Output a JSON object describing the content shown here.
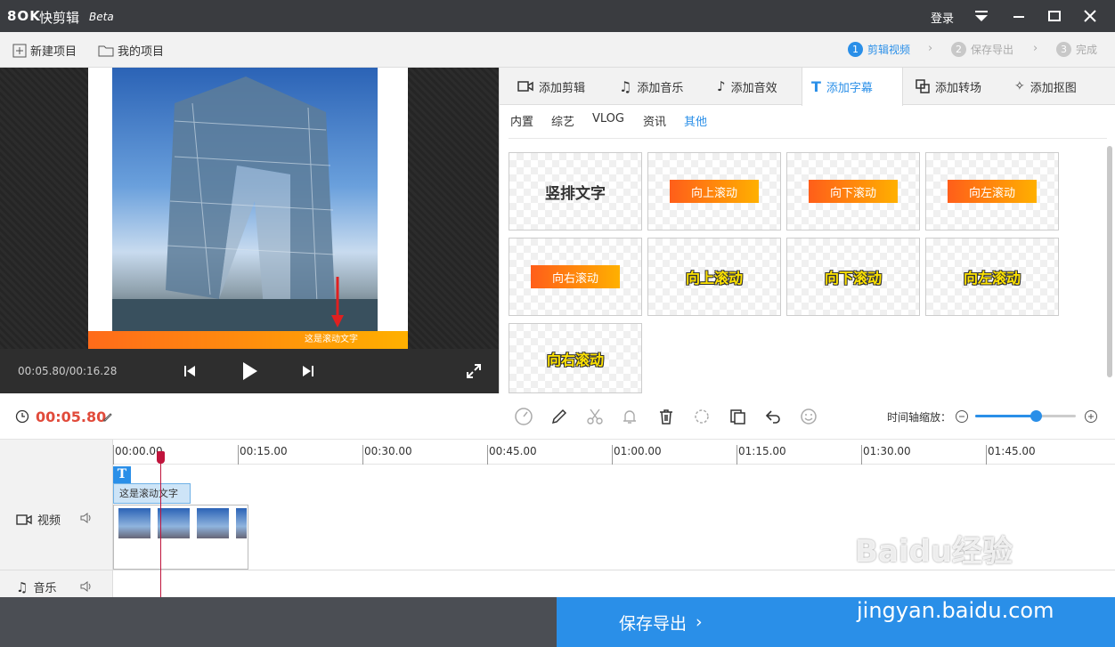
{
  "titlebar": {
    "logo": "8OK",
    "app_name": "快剪辑",
    "beta": "Beta",
    "login": "登录"
  },
  "toolbar": {
    "new_project": "新建项目",
    "my_projects": "我的项目"
  },
  "steps": [
    {
      "num": "1",
      "label": "剪辑视频",
      "active": true
    },
    {
      "num": "2",
      "label": "保存导出",
      "active": false
    },
    {
      "num": "3",
      "label": "完成",
      "active": false
    }
  ],
  "preview": {
    "caption": "这是滚动文字",
    "timecode": "00:05.80/00:16.28"
  },
  "tabs": [
    "添加剪辑",
    "添加音乐",
    "添加音效",
    "添加字幕",
    "添加转场",
    "添加抠图"
  ],
  "active_tab": "添加字幕",
  "subtabs": [
    "内置",
    "综艺",
    "VLOG",
    "资讯",
    "其他"
  ],
  "active_subtab": "其他",
  "tiles": [
    {
      "label": "竖排文字",
      "style": "plain"
    },
    {
      "label": "向上滚动",
      "style": "bar"
    },
    {
      "label": "向下滚动",
      "style": "bar"
    },
    {
      "label": "向左滚动",
      "style": "bar"
    },
    {
      "label": "向右滚动",
      "style": "bar"
    },
    {
      "label": "向上滚动",
      "style": "yellow"
    },
    {
      "label": "向下滚动",
      "style": "yellow"
    },
    {
      "label": "向左滚动",
      "style": "yellow"
    },
    {
      "label": "向右滚动",
      "style": "yellow"
    }
  ],
  "editbar": {
    "current_time": "00:05.80",
    "zoom_label": "时间轴缩放：",
    "zoom_level": 0.6
  },
  "ruler": [
    "00:00.00",
    "00:15.00",
    "00:30.00",
    "00:45.00",
    "01:00.00",
    "01:15.00",
    "01:30.00",
    "01:45.00"
  ],
  "tracks": {
    "video": "视频",
    "music": "音乐",
    "text_clip": "这是滚动文字",
    "text_icon": "T"
  },
  "export_label": "保存导出",
  "watermark": {
    "brand": "Baidu经验",
    "url": "jingyan.baidu.com"
  },
  "colors": {
    "accent": "#2a8fe8",
    "time": "#e14b3b",
    "playhead": "#c0143c"
  }
}
